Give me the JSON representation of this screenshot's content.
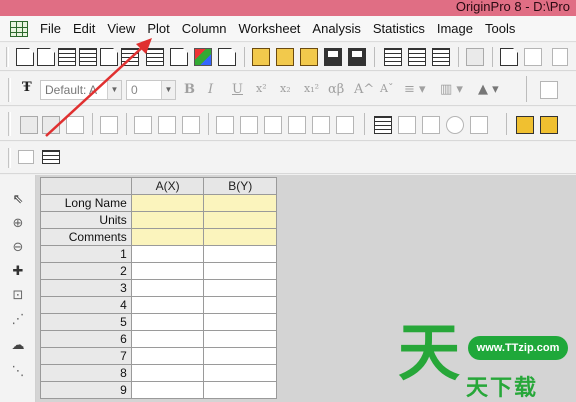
{
  "window": {
    "title": "OriginPro 8 - D:\\Pro"
  },
  "menu": [
    "File",
    "Edit",
    "View",
    "Plot",
    "Column",
    "Worksheet",
    "Analysis",
    "Statistics",
    "Image",
    "Tools"
  ],
  "format_toolbar": {
    "font_value": "Default: A",
    "size_value": "0",
    "bold": "B",
    "italic": "I",
    "underline": "U",
    "superscript": "x²",
    "subscript": "x₂",
    "supersub": "x₁²",
    "greek": "αβ",
    "grow_font": "A^",
    "shrink_font": "Aˇ"
  },
  "icons": {
    "text-font": "Ŧ",
    "pointer": "⇖",
    "zoom-in": "⊕",
    "zoom-out": "⊖",
    "data-reader": "✚",
    "scale": "⊡",
    "screen-reader": "⋰",
    "region": "☁",
    "mask": "⋱"
  },
  "worksheet": {
    "columns": [
      "A(X)",
      "B(Y)"
    ],
    "meta_rows": [
      "Long Name",
      "Units",
      "Comments"
    ],
    "row_numbers": [
      "1",
      "2",
      "3",
      "4",
      "5",
      "6",
      "7",
      "8",
      "9"
    ]
  },
  "watermark": {
    "url": "www.TTzip.com",
    "big_char": "天",
    "small_text": "天下载"
  },
  "colors": {
    "titlebar": "#e06e84",
    "meta_cell": "#fbf4bd",
    "arrow": "#e03030",
    "watermark": "#27a739"
  }
}
